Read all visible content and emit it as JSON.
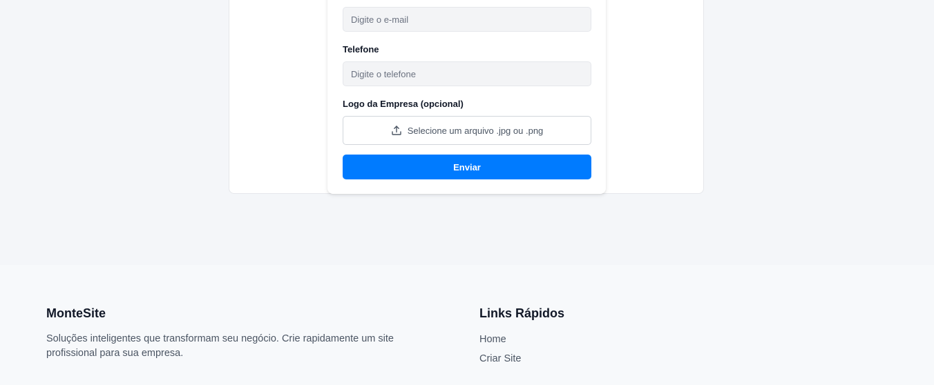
{
  "form": {
    "email": {
      "placeholder": "Digite o e-mail"
    },
    "phone": {
      "label": "Telefone",
      "placeholder": "Digite o telefone"
    },
    "logo": {
      "label": "Logo da Empresa (opcional)",
      "upload_text": "Selecione um arquivo .jpg ou .png",
      "icon": "upload-icon"
    },
    "submit_label": "Enviar"
  },
  "footer": {
    "brand": "MonteSite",
    "description": "Soluções inteligentes que transformam seu negócio. Crie rapidamente um site profissional para sua empresa.",
    "links_title": "Links Rápidos",
    "links": [
      {
        "label": "Home"
      },
      {
        "label": "Criar Site"
      }
    ]
  },
  "colors": {
    "primary": "#007bff",
    "background": "#f4f6f9",
    "footer_background": "#f7f9fb"
  }
}
